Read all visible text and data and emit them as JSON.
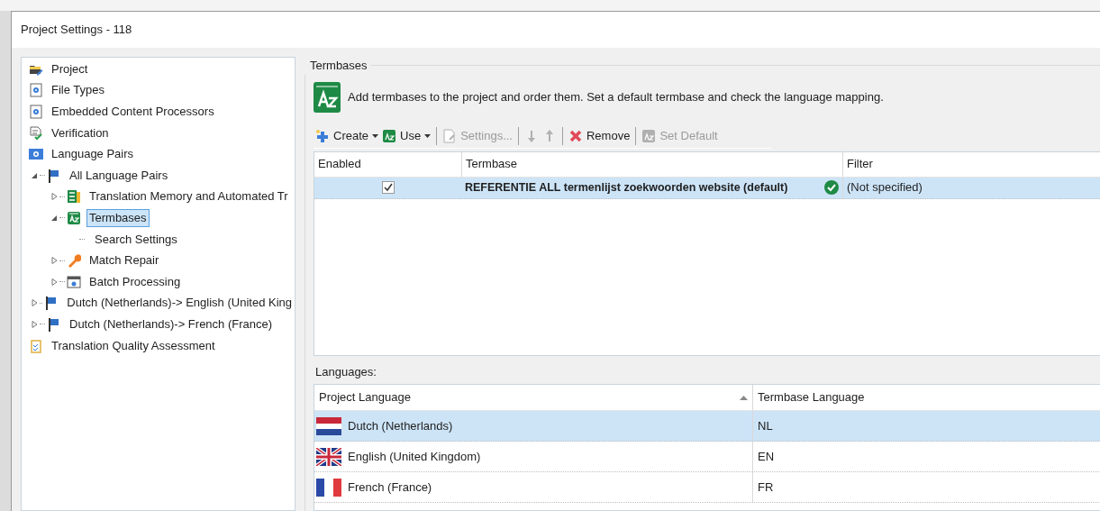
{
  "window": {
    "title": "Project Settings - 118"
  },
  "tree": [
    {
      "label": "Project",
      "selected": false
    },
    {
      "label": "File Types",
      "selected": false
    },
    {
      "label": "Embedded Content Processors",
      "selected": false
    },
    {
      "label": "Verification",
      "selected": false
    },
    {
      "label": "Language Pairs",
      "selected": false
    },
    {
      "label": "All Language Pairs",
      "selected": false,
      "expanded": true,
      "children": [
        {
          "label": "Translation Memory and Automated Tr",
          "selected": false,
          "expanded": false
        },
        {
          "label": "Termbases",
          "selected": true,
          "expanded": true,
          "children": [
            {
              "label": "Search Settings",
              "selected": false
            }
          ]
        },
        {
          "label": "Match Repair",
          "selected": false,
          "expanded": false
        },
        {
          "label": "Batch Processing",
          "selected": false,
          "expanded": false
        }
      ]
    },
    {
      "label": "Dutch (Netherlands)-> English (United King",
      "selected": false,
      "expanded": false
    },
    {
      "label": "Dutch (Netherlands)-> French (France)",
      "selected": false,
      "expanded": false
    },
    {
      "label": "Translation Quality Assessment",
      "selected": false
    }
  ],
  "section": {
    "title": "Termbases",
    "description": "Add termbases to the project and order them. Set a default termbase and check the language mapping."
  },
  "toolbar": [
    {
      "label": "Create",
      "dropdown": true,
      "disabled": false
    },
    {
      "label": "Use",
      "dropdown": true,
      "disabled": false
    },
    {
      "label": "Settings...",
      "dropdown": false,
      "disabled": true
    },
    {
      "dropdown": false,
      "disabled": true
    },
    {
      "dropdown": false,
      "disabled": true
    },
    {
      "label": "Remove",
      "dropdown": false,
      "disabled": false
    },
    {
      "label": "Set Default",
      "dropdown": false,
      "disabled": true
    }
  ],
  "termbases": {
    "columns": [
      "Enabled",
      "Termbase",
      "Filter"
    ],
    "rows": [
      {
        "enabled": true,
        "termbase": "REFERENTIE ALL termenlijst zoekwoorden website (default)",
        "valid": true,
        "filter": "(Not specified)",
        "selected": true
      }
    ]
  },
  "languages": {
    "label": "Languages:",
    "columns": [
      {
        "label": "Project Language",
        "sorted": true
      },
      {
        "label": "Termbase Language",
        "sorted": false
      }
    ],
    "rows": [
      {
        "language": "Dutch (Netherlands)",
        "code": "NL",
        "selected": true
      },
      {
        "language": "English (United Kingdom)",
        "code": "EN",
        "selected": false
      },
      {
        "language": "French (France)",
        "code": "FR",
        "selected": false
      }
    ]
  }
}
